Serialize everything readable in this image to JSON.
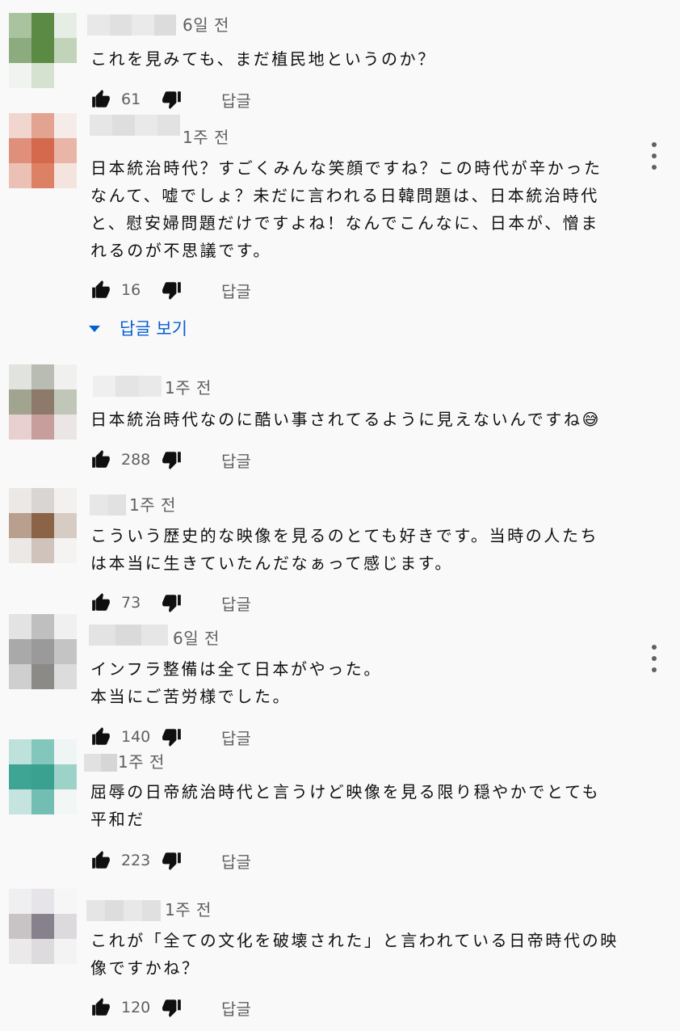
{
  "colors": {
    "text": "#0f0f0f",
    "secondary": "#606060",
    "link": "#065fd4",
    "background": "#f9f9f9"
  },
  "comments": [
    {
      "time": "6일 전",
      "text": "これを見みても、まだ植民地というのか？",
      "likes": "61",
      "reply": "답글",
      "avatar": [
        "#a9c39f",
        "#5b8a44",
        "#e6ede4",
        "#8cab7e",
        "#5b8a44",
        "#c1d3b9",
        "#f0f3ef",
        "#d5e2d0",
        "#f9f9f9"
      ],
      "name_blur": [
        "#e8e8e8",
        "#e0e0e0",
        "#eaeaea",
        "#dcdcdc"
      ]
    },
    {
      "time": "1주 전",
      "text": "日本統治時代？すごくみんな笑顔ですね？この時代が辛かった\nなんて、嘘でしょ？未だに言われる日韓問題は、日本統治時代\nと、慰安婦問題だけですよね！なんでこんなに、日本が、憎ま\nれるのが不思議です。",
      "likes": "16",
      "reply": "답글",
      "avatar": [
        "#f1d6d0",
        "#e3a391",
        "#f5ece9",
        "#df8f7b",
        "#d5694d",
        "#e9b5a7",
        "#ebc1b6",
        "#dc8164",
        "#f5e3dd"
      ],
      "name_blur": [
        "#e6e6e6",
        "#dedede",
        "#e9e9e9",
        "#e2e2e2"
      ]
    },
    {
      "time": "1주 전",
      "text": "日本統治時代なのに酷い事されてるように見えないんですね😅",
      "likes": "288",
      "reply": "답글",
      "avatar": [
        "#e1e3df",
        "#b8bcb3",
        "#f0f0ee",
        "#a1a48f",
        "#8e7a6b",
        "#c0c7b8",
        "#e8cfd0",
        "#c79e9c",
        "#ece5e5"
      ],
      "name_blur": [
        "#efefef",
        "#e4e4e4",
        "#e9e9e9"
      ]
    },
    {
      "time": "1주 전",
      "text": "こういう歴史的な映像を見るのとても好きです。当時の人たち\nは本当に生きていたんだなぁって感じます。",
      "likes": "73",
      "reply": "답글",
      "avatar": [
        "#ece8e5",
        "#d9d5d2",
        "#f3f1ef",
        "#b9a08e",
        "#8b6448",
        "#d7ccc4",
        "#ebe8e6",
        "#cfc3bb",
        "#f4f3f2"
      ],
      "name_blur": [
        "#e7e7e7",
        "#e1e1e1"
      ]
    },
    {
      "time": "6일 전",
      "text": "インフラ整備は全て日本がやった。\n本当にご苦労様でした。",
      "likes": "140",
      "reply": "답글",
      "avatar": [
        "#e3e3e3",
        "#bfbfbf",
        "#f0f0f0",
        "#a9a9a9",
        "#9a9a9a",
        "#c4c4c4",
        "#cfcfcf",
        "#8c8a87",
        "#dcdcdc"
      ],
      "name_blur": [
        "#e3e3e3",
        "#dadada",
        "#e6e6e6"
      ]
    },
    {
      "time": "1주 전",
      "text": "屈辱の日帝統治時代と言うけど映像を見る限り穏やかでとても\n平和だ",
      "likes": "223",
      "reply": "답글",
      "avatar": [
        "#bfe1db",
        "#83c7bc",
        "#eef5f4",
        "#3ea595",
        "#3aa191",
        "#9dd2c9",
        "#c5e4df",
        "#72beb2",
        "#f2f7f6"
      ],
      "name_blur": [
        "#e1e1e1",
        "#d6d6d6"
      ]
    },
    {
      "time": "1주 전",
      "text": "これが「全ての文化を破壊された」と言われている日帝時代の映\n像ですかね？",
      "likes": "120",
      "reply": "답글",
      "avatar": [
        "#efeef0",
        "#e6e4e8",
        "#f6f6f6",
        "#c8c4c6",
        "#87818e",
        "#dcdadd",
        "#ebe9ea",
        "#dddbdd",
        "#f3f3f3"
      ],
      "name_blur": [
        "#e5e5e5",
        "#dddddd",
        "#e8e8e8",
        "#e0e0e0"
      ]
    }
  ],
  "view_replies": "답글 보기",
  "icons": {
    "like": "thumb-up-icon",
    "dislike": "thumb-down-icon",
    "menu": "more-vert-icon"
  }
}
